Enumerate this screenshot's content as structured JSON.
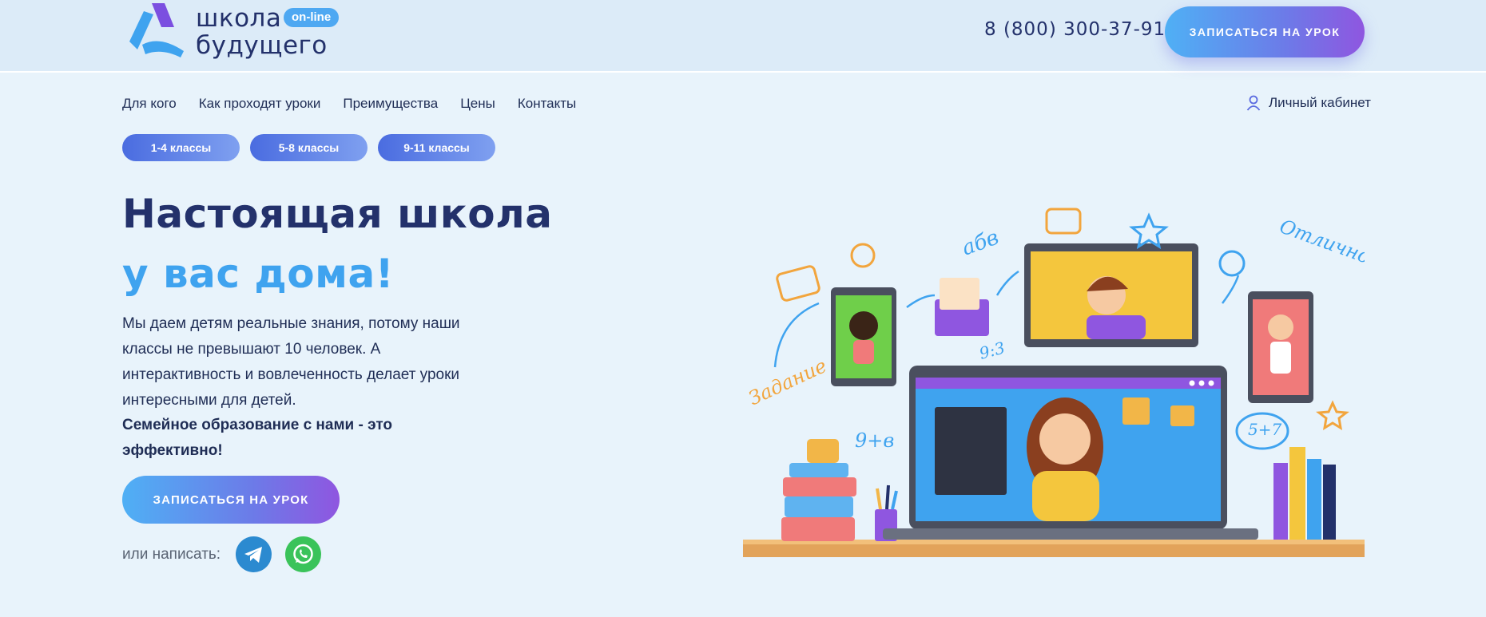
{
  "header": {
    "logo": {
      "line1": "школа",
      "line2": "будущего",
      "badge": "on-line"
    },
    "phone": "8 (800) 300-37-91",
    "cta_label": "ЗАПИСАТЬСЯ НА УРОК"
  },
  "nav": {
    "items": [
      {
        "label": "Для кого"
      },
      {
        "label": "Как проходят уроки"
      },
      {
        "label": "Преимущества"
      },
      {
        "label": "Цены"
      },
      {
        "label": "Контакты"
      }
    ],
    "cabinet_label": "Личный кабинет"
  },
  "grades": [
    {
      "label": "1-4 классы"
    },
    {
      "label": "5-8 классы"
    },
    {
      "label": "9-11 классы"
    }
  ],
  "hero": {
    "title_line1": "Настоящая школа",
    "title_line2": "у вас дома!",
    "description": "Мы даем детям реальные знания, потому наши классы не превышают 10 человек. А интерактивность и вовлеченность делает уроки интересными для детей.",
    "description_bold": "Семейное образование с нами - это эффективно!",
    "cta_label": "ЗАПИСАТЬСЯ НА УРОК",
    "write_label": "или написать:"
  },
  "illustration": {
    "handwriting": [
      "абв",
      "Отлично!",
      "Задание",
      "9:3",
      "9+в",
      "5+7"
    ]
  },
  "colors": {
    "navy": "#23316b",
    "accent_blue": "#3fa3ef",
    "gradient_start": "#4fb0f5",
    "gradient_end": "#8f56e0",
    "telegram": "#2b8ad0",
    "whatsapp": "#3ac35a"
  },
  "icons": [
    "logo-mark-icon",
    "user-icon",
    "telegram-icon",
    "whatsapp-icon"
  ]
}
